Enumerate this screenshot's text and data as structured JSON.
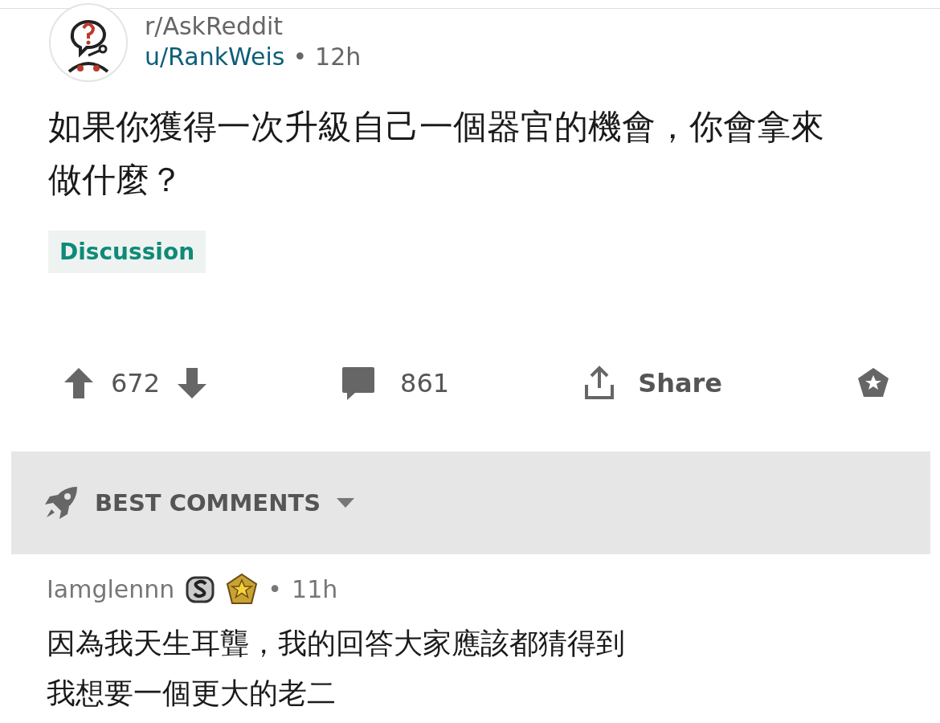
{
  "post": {
    "subreddit": "r/AskReddit",
    "author": "u/RankWeis",
    "separator": "•",
    "time": "12h",
    "title": "如果你獲得一次升級自己一個器官的機會，你會拿來做什麼？",
    "flair": "Discussion"
  },
  "actions": {
    "score": "672",
    "comments": "861",
    "share": "Share"
  },
  "sort": {
    "label": "BEST COMMENTS"
  },
  "comments": [
    {
      "author": "Iamglennn",
      "separator": "•",
      "time": "11h",
      "lines": [
        "因為我天生耳聾，我的回答大家應該都猜得到",
        "我想要一個更大的老二"
      ]
    }
  ]
}
